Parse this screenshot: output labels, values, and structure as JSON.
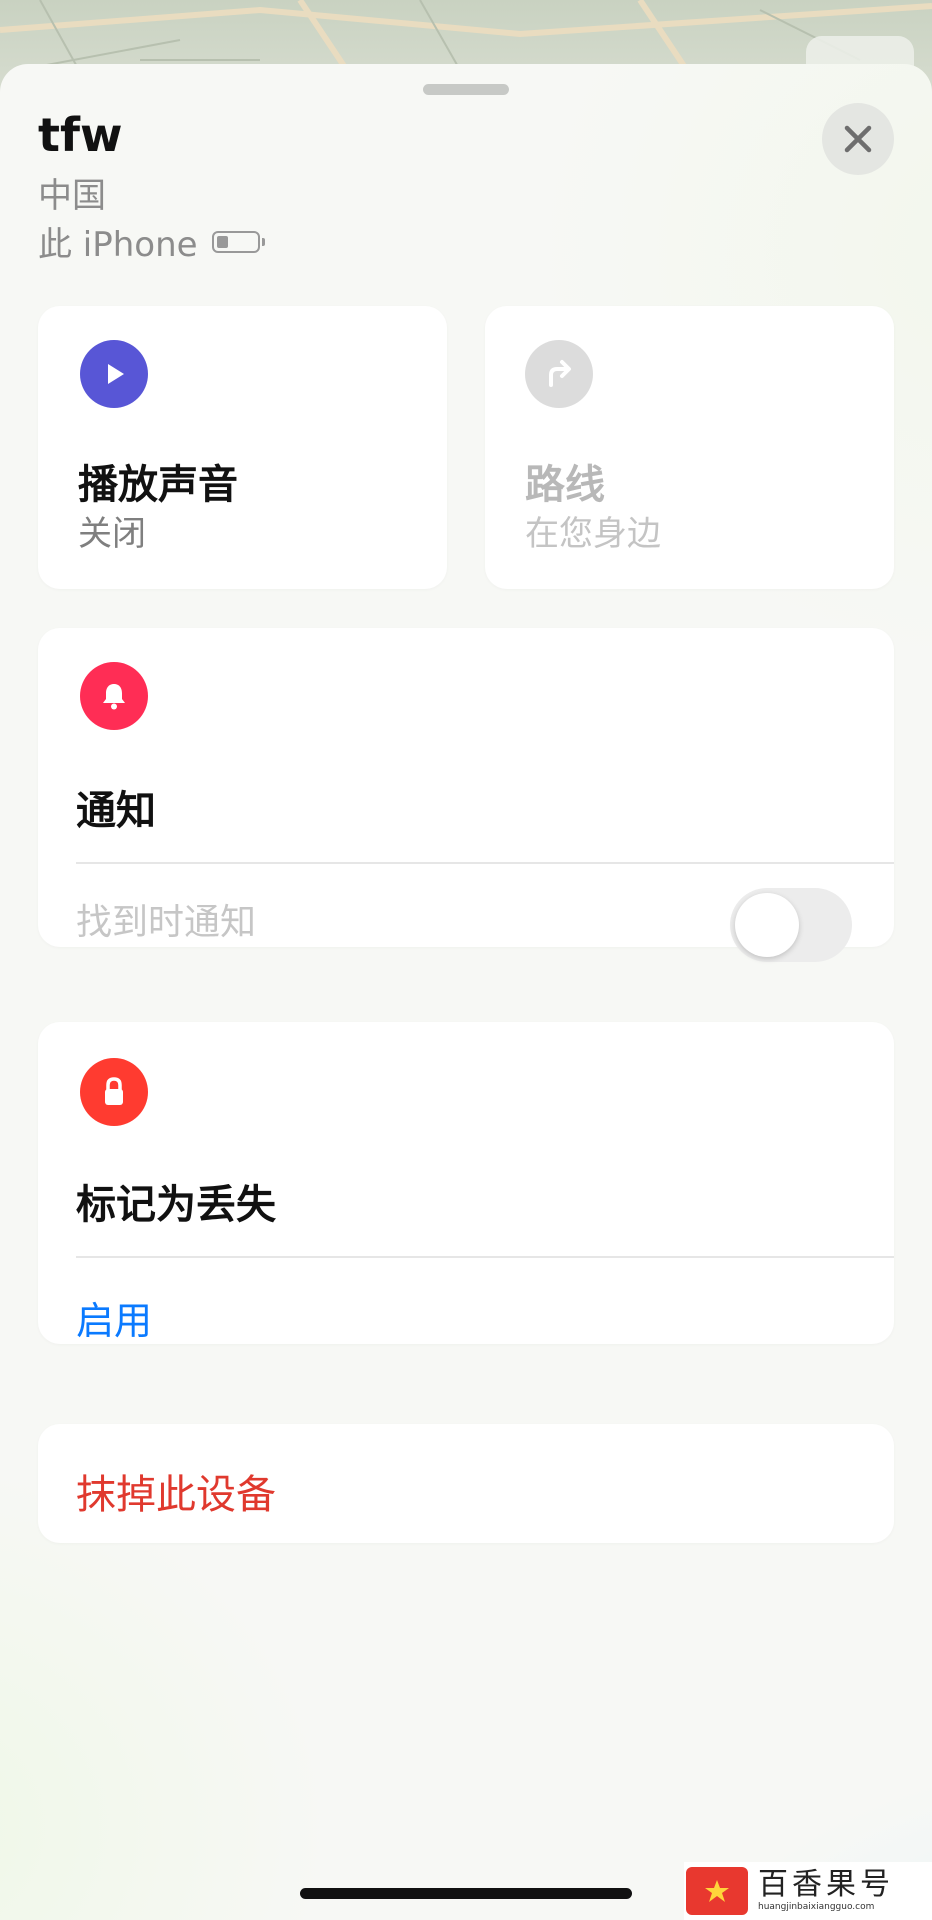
{
  "header": {
    "title": "tfw",
    "location": "中国",
    "device": "此 iPhone",
    "battery_level": 0.3
  },
  "actions": {
    "play_sound": {
      "title": "播放声音",
      "status": "关闭",
      "icon": "play-icon",
      "color": "#5856d6"
    },
    "directions": {
      "title": "路线",
      "status": "在您身边",
      "icon": "turn-right-arrow-icon",
      "color": "#d9d9d9"
    }
  },
  "notifications": {
    "title": "通知",
    "icon": "bell-icon",
    "color": "#ff2d55",
    "notify_when_found": {
      "label": "找到时通知",
      "enabled": false
    }
  },
  "lost_mode": {
    "title": "标记为丢失",
    "icon": "lock-icon",
    "color": "#ff3b30",
    "action": "启用",
    "action_color": "#0a7aff"
  },
  "erase": {
    "label": "抹掉此设备",
    "color": "#e0392e"
  },
  "watermark": {
    "name": "百香果号",
    "url": "huangjinbaixiangguo.com"
  }
}
